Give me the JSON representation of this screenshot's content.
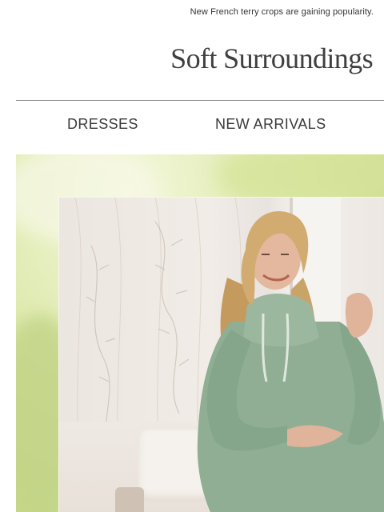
{
  "preheader": {
    "text": "New French terry crops are gaining popularity."
  },
  "brand": {
    "name": "Soft Surroundings"
  },
  "nav": {
    "items": [
      "DRESSES",
      "NEW ARRIVALS"
    ]
  },
  "hero": {
    "alt": "Woman wearing a sage green cowl-neck knit tunic"
  },
  "colors": {
    "text": "#3a3a3a",
    "divider": "#8c8c8c",
    "sweater": "#8fae94",
    "hair": "#c9a26a"
  }
}
